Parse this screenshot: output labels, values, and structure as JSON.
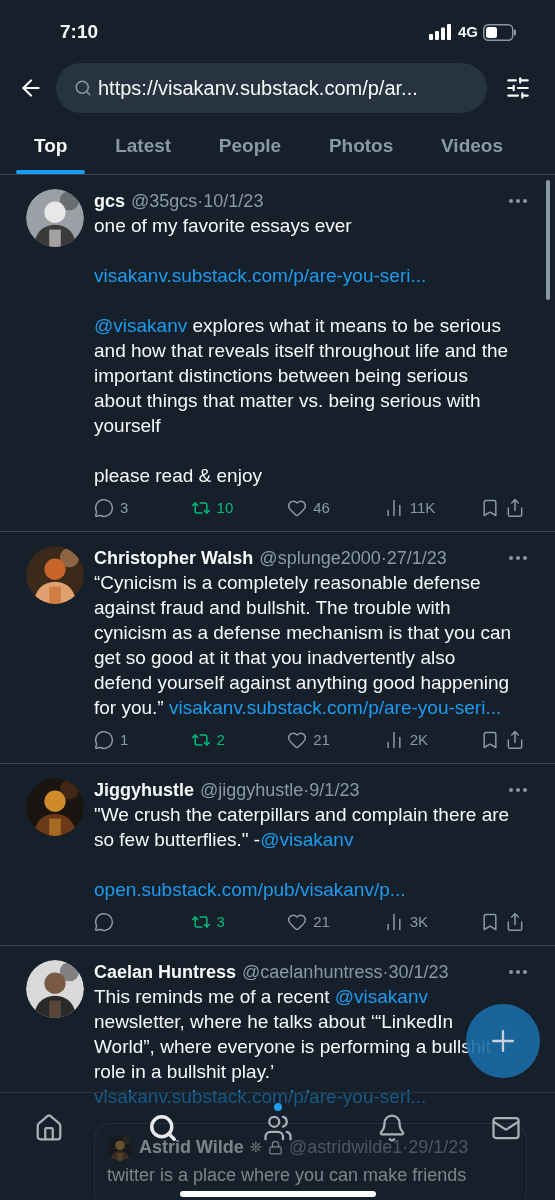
{
  "status_bar": {
    "time": "7:10",
    "network": "4G"
  },
  "search": {
    "value": "https://visakanv.substack.com/p/ar..."
  },
  "tabs": [
    {
      "label": "Top",
      "selected": true
    },
    {
      "label": "Latest",
      "selected": false
    },
    {
      "label": "People",
      "selected": false
    },
    {
      "label": "Photos",
      "selected": false
    },
    {
      "label": "Videos",
      "selected": false
    }
  ],
  "tweets": [
    {
      "name": "gcs",
      "handle": "@35gcs",
      "date": "·10/1/23",
      "paragraphs": [
        [
          {
            "kind": "text",
            "text": "one of my favorite essays ever"
          }
        ],
        [
          {
            "kind": "link",
            "text": "visakanv.substack.com/p/are-you-seri..."
          }
        ],
        [
          {
            "kind": "mention",
            "text": "@visakanv"
          },
          {
            "kind": "text",
            "text": " explores what it means to be serious and how that reveals itself throughout life and the important distinctions between being serious about things that matter vs. being serious with yourself"
          }
        ],
        [
          {
            "kind": "text",
            "text": "please read & enjoy"
          }
        ]
      ],
      "metrics": [
        {
          "kind": "reply",
          "count": "3"
        },
        {
          "kind": "retweet",
          "count": "10",
          "active": true
        },
        {
          "kind": "like",
          "count": "46"
        },
        {
          "kind": "views",
          "count": "11K"
        },
        {
          "kind": "bookmark"
        },
        {
          "kind": "share"
        }
      ]
    },
    {
      "name": "Christopher Walsh",
      "handle": "@splunge2000",
      "date": "·27/1/23",
      "paragraphs": [
        [
          {
            "kind": "text",
            "text": "“Cynicism is a completely reasonable defense against fraud and bullshit. The trouble with cynicism as a defense mechanism is that you can get so good at it that you inadvertently also defend yourself against anything good happening for you.” "
          },
          {
            "kind": "link",
            "text": "visakanv.substack.com/p/are-you-seri..."
          }
        ]
      ],
      "metrics": [
        {
          "kind": "reply",
          "count": "1"
        },
        {
          "kind": "retweet",
          "count": "2",
          "active": true
        },
        {
          "kind": "like",
          "count": "21"
        },
        {
          "kind": "views",
          "count": "2K"
        },
        {
          "kind": "bookmark"
        },
        {
          "kind": "share"
        }
      ]
    },
    {
      "name": "Jiggyhustle",
      "handle": "@jiggyhustle",
      "date": "·9/1/23",
      "paragraphs": [
        [
          {
            "kind": "text",
            "text": "\"We crush the caterpillars and complain there are so few butterflies.\" -"
          },
          {
            "kind": "mention",
            "text": "@visakanv"
          }
        ],
        [
          {
            "kind": "link",
            "text": "open.substack.com/pub/visakanv/p..."
          }
        ]
      ],
      "metrics": [
        {
          "kind": "reply"
        },
        {
          "kind": "retweet",
          "count": "3",
          "active": true
        },
        {
          "kind": "like",
          "count": "21"
        },
        {
          "kind": "views",
          "count": "3K"
        },
        {
          "kind": "bookmark"
        },
        {
          "kind": "share"
        }
      ]
    },
    {
      "name": "Caelan Huntress",
      "handle": "@caelanhuntress",
      "date": "·30/1/23",
      "paragraphs": [
        [
          {
            "kind": "text",
            "text": "This reminds me of a recent "
          },
          {
            "kind": "mention",
            "text": "@visakanv"
          },
          {
            "kind": "text",
            "text": " newsletter, where he talks about ‘“LinkedIn World”, where everyone is performing a bullshit role in a bullshit play.’"
          },
          {
            "kind": "break"
          },
          {
            "kind": "link",
            "text": "visakanv.substack.com/p/are-you-seri..."
          }
        ]
      ],
      "quote": {
        "name": "Astrid Wilde",
        "badge": "❊",
        "locked": true,
        "handle": "@astridwilde1",
        "date": "·29/1/23",
        "text": "twitter is a place where you can make friends"
      }
    }
  ],
  "nav": [
    {
      "kind": "home",
      "selected": false
    },
    {
      "kind": "search",
      "selected": true
    },
    {
      "kind": "communities",
      "selected": false,
      "badge": true
    },
    {
      "kind": "notifications",
      "selected": false
    },
    {
      "kind": "messages",
      "selected": false
    }
  ]
}
